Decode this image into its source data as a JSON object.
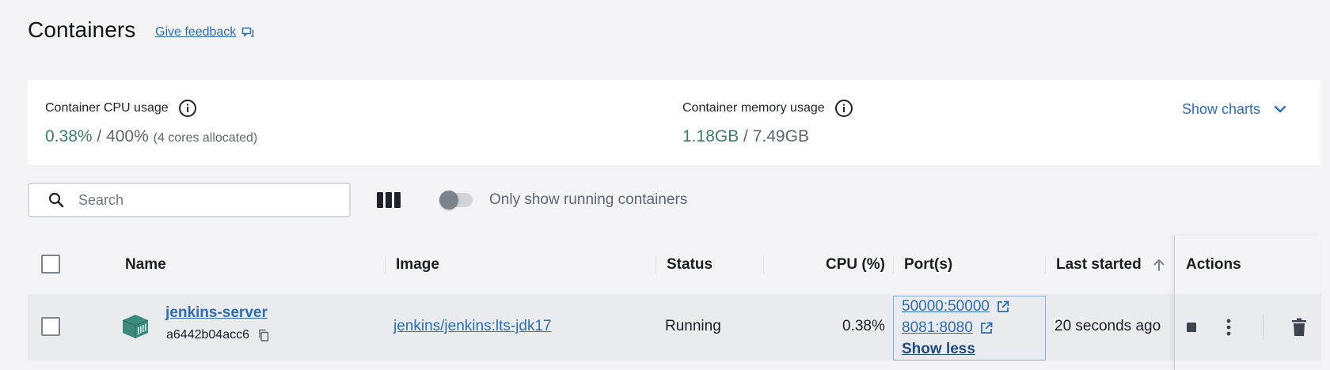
{
  "page": {
    "title": "Containers",
    "feedback_label": "Give feedback"
  },
  "stats": {
    "cpu": {
      "label": "Container CPU usage",
      "value": "0.38%",
      "separator": " / ",
      "total": "400%",
      "note": "(4 cores allocated)"
    },
    "memory": {
      "label": "Container memory usage",
      "value": "1.18GB",
      "separator": " / ",
      "total": "7.49GB"
    },
    "show_charts_label": "Show charts"
  },
  "toolbar": {
    "search_placeholder": "Search",
    "toggle_label": "Only show running containers",
    "toggle_on": false
  },
  "table": {
    "columns": {
      "name": "Name",
      "image": "Image",
      "status": "Status",
      "cpu": "CPU (%)",
      "ports": "Port(s)",
      "last_started": "Last started",
      "actions": "Actions"
    },
    "rows": [
      {
        "name": "jenkins-server",
        "id": "a6442b04acc6",
        "image": "jenkins/jenkins:lts-jdk17",
        "status": "Running",
        "cpu": "0.38%",
        "ports": [
          "50000:50000",
          "8081:8080"
        ],
        "ports_toggle": "Show less",
        "last_started": "20 seconds ago"
      }
    ]
  },
  "colors": {
    "accent_link": "#2f6db2",
    "usage_value": "#3f7a68",
    "container_icon": "#3c8a7a"
  },
  "icons": {
    "feedback": "chat-external-icon",
    "info": "info-icon",
    "chevron": "chevron-down-icon",
    "search": "search-icon",
    "columns": "columns-icon",
    "container": "container-cube-icon",
    "copy": "copy-icon",
    "external": "external-link-icon",
    "stop": "stop-icon",
    "more": "more-vertical-icon",
    "delete": "trash-icon",
    "sort": "arrow-up-icon"
  }
}
